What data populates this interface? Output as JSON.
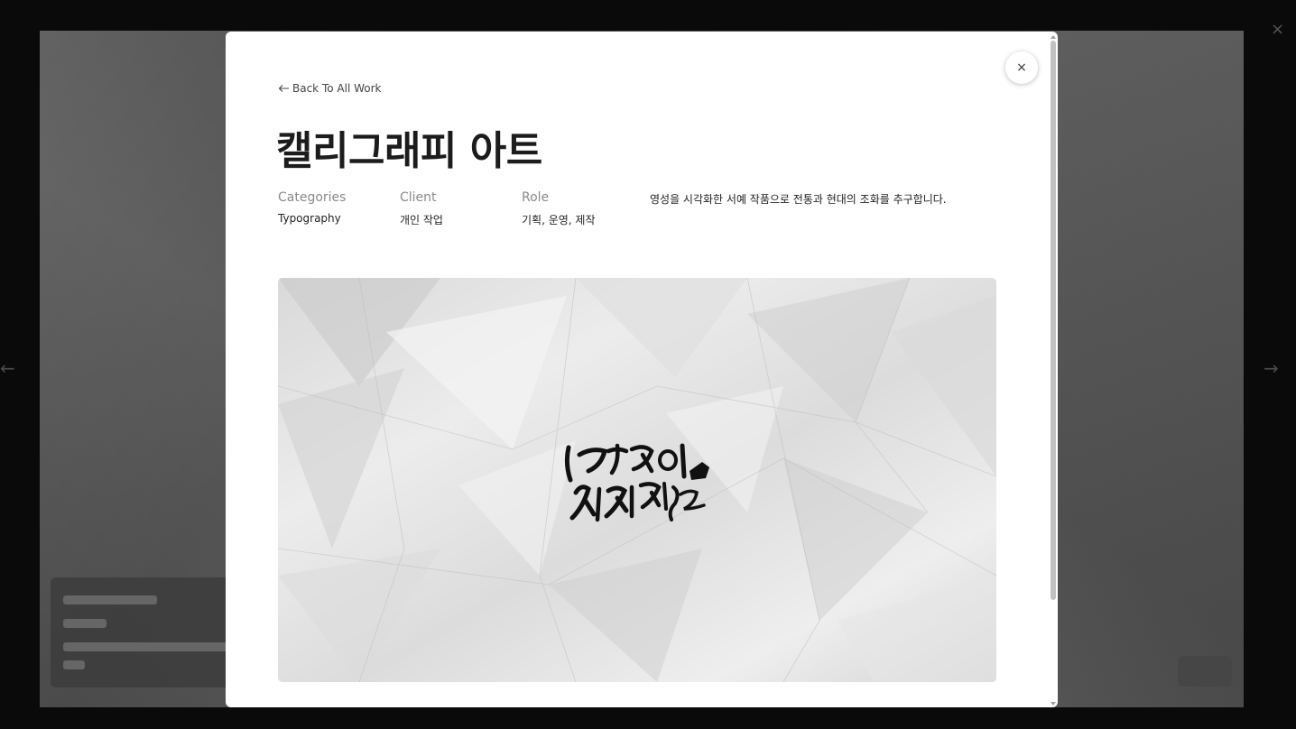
{
  "modal": {
    "close_icon": "×",
    "back_link": "Back To All Work",
    "title": "캘리그래피 아트",
    "meta": [
      {
        "label": "Categories",
        "value": "Typography"
      },
      {
        "label": "Client",
        "value": "개인 작업"
      },
      {
        "label": "Role",
        "value": "기획, 운영, 제작"
      }
    ],
    "description": "영성을 시각화한 서예 작품으로 전통과 현대의 조화를 추구합니다.",
    "hero_image": {
      "lettering_line1": "멋쟁이",
      "lettering_line2": "사자처럼"
    }
  },
  "background": {
    "close_icon": "×",
    "prev_arrow": "←",
    "next_arrow": "→"
  }
}
